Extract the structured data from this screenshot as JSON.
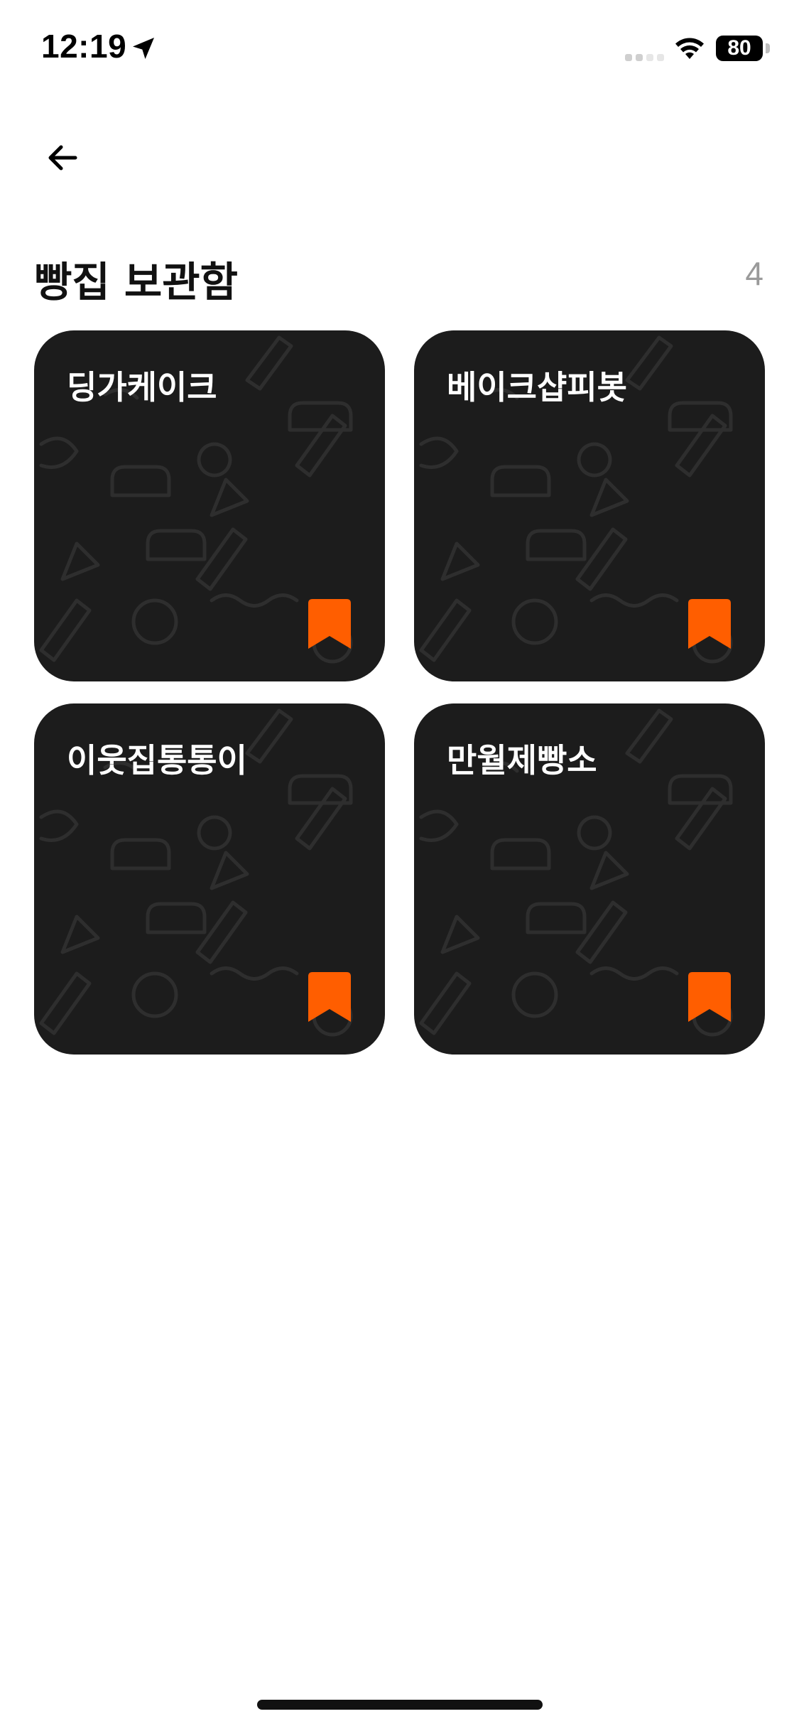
{
  "status_bar": {
    "time": "12:19",
    "battery": "80",
    "icons": [
      "location-arrow-icon",
      "signal-icon",
      "wifi-icon",
      "battery-icon"
    ]
  },
  "nav": {
    "back_icon": "arrow-left-icon"
  },
  "header": {
    "title": "빵집 보관함",
    "count": "4"
  },
  "cards": [
    {
      "name": "딩가케이크",
      "bookmarked": true
    },
    {
      "name": "베이크샵피봇",
      "bookmarked": true
    },
    {
      "name": "이웃집통통이",
      "bookmarked": true
    },
    {
      "name": "만월제빵소",
      "bookmarked": true
    }
  ],
  "colors": {
    "card_background": "#1c1c1c",
    "bookmark": "#ff5e00",
    "count_text": "#9a9a9a"
  }
}
